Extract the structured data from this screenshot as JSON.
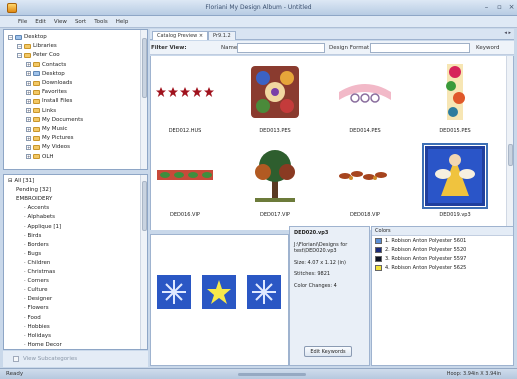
{
  "window": {
    "title": "Floriani My Design Album - Untitled"
  },
  "menu": [
    "File",
    "Edit",
    "View",
    "Sort",
    "Tools",
    "Help"
  ],
  "folder_tree": [
    {
      "label": "Desktop",
      "level": 0,
      "icon": "folder-blue-icon"
    },
    {
      "label": "Libraries",
      "level": 1,
      "icon": "folder-icon"
    },
    {
      "label": "Peter Coo",
      "level": 1,
      "icon": "folder-icon"
    },
    {
      "label": "Contacts",
      "level": 2,
      "icon": "folder-icon"
    },
    {
      "label": "Desktop",
      "level": 2,
      "icon": "folder-blue-icon"
    },
    {
      "label": "Downloads",
      "level": 2,
      "icon": "folder-icon"
    },
    {
      "label": "Favorites",
      "level": 2,
      "icon": "folder-icon"
    },
    {
      "label": "Install Files",
      "level": 2,
      "icon": "folder-icon"
    },
    {
      "label": "Links",
      "level": 2,
      "icon": "folder-icon"
    },
    {
      "label": "My Documents",
      "level": 2,
      "icon": "folder-icon"
    },
    {
      "label": "My Music",
      "level": 2,
      "icon": "folder-icon"
    },
    {
      "label": "My Pictures",
      "level": 2,
      "icon": "folder-icon"
    },
    {
      "label": "My Videos",
      "level": 2,
      "icon": "folder-icon"
    },
    {
      "label": "OLH",
      "level": 2,
      "icon": "folder-icon"
    }
  ],
  "categories": [
    {
      "label": "All [31]",
      "level": 0
    },
    {
      "label": "Pending [32]",
      "level": 1
    },
    {
      "label": "EMBROIDERY",
      "level": 1
    },
    {
      "label": "Accents",
      "level": 2
    },
    {
      "label": "Alphabets",
      "level": 2
    },
    {
      "label": "Applique [1]",
      "level": 2
    },
    {
      "label": "Birds",
      "level": 2
    },
    {
      "label": "Borders",
      "level": 2
    },
    {
      "label": "Bugs",
      "level": 2
    },
    {
      "label": "Children",
      "level": 2
    },
    {
      "label": "Christmas",
      "level": 2
    },
    {
      "label": "Corners",
      "level": 2
    },
    {
      "label": "Culture",
      "level": 2
    },
    {
      "label": "Designer",
      "level": 2
    },
    {
      "label": "Flowers",
      "level": 2
    },
    {
      "label": "Food",
      "level": 2
    },
    {
      "label": "Hobbies",
      "level": 2
    },
    {
      "label": "Holidays",
      "level": 2
    },
    {
      "label": "Home Decor",
      "level": 2
    }
  ],
  "view_subcategories": "View Subcategories",
  "tabs": [
    "Catalog Preview",
    "Pr9.1.2"
  ],
  "filter": {
    "label": "Filter View:",
    "name_label": "Name",
    "format_label": "Design Format",
    "keyword_label": "Keyword"
  },
  "designs": [
    {
      "name": "DED012.HUS",
      "art": "stars"
    },
    {
      "name": "DED013.PES",
      "art": "floral"
    },
    {
      "name": "DED014.PES",
      "art": "banner"
    },
    {
      "name": "DED015.PES",
      "art": "vine"
    },
    {
      "name": "DED016.VIP",
      "art": "border"
    },
    {
      "name": "DED017.VIP",
      "art": "tree"
    },
    {
      "name": "DED018.VIP",
      "art": "leaves"
    },
    {
      "name": "DED019.vp3",
      "art": "angel"
    }
  ],
  "selected": {
    "filename": "DED020.vp3",
    "path": "J:\\Floriani\\Designs for test\\DED020.vp3",
    "size": "Size: 4.07 x 1.12 (in)",
    "stitches": "Stitches: 9821",
    "color_changes": "Color Changes: 4",
    "edit_button": "Edit Keywords"
  },
  "colors_header": "Colors",
  "colors": [
    {
      "label": "1. Robison Anton Polyester 5601",
      "hex": "#5b8fd6"
    },
    {
      "label": "2. Robison Anton Polyester 5520",
      "hex": "#1a2a7a"
    },
    {
      "label": "3. Robison Anton Polyester 5597",
      "hex": "#0c1222"
    },
    {
      "label": "4. Robison Anton Polyester 5625",
      "hex": "#f2e23a"
    }
  ],
  "status": {
    "left": "Ready",
    "right": "Hoop: 3.94in X 3.94in"
  }
}
